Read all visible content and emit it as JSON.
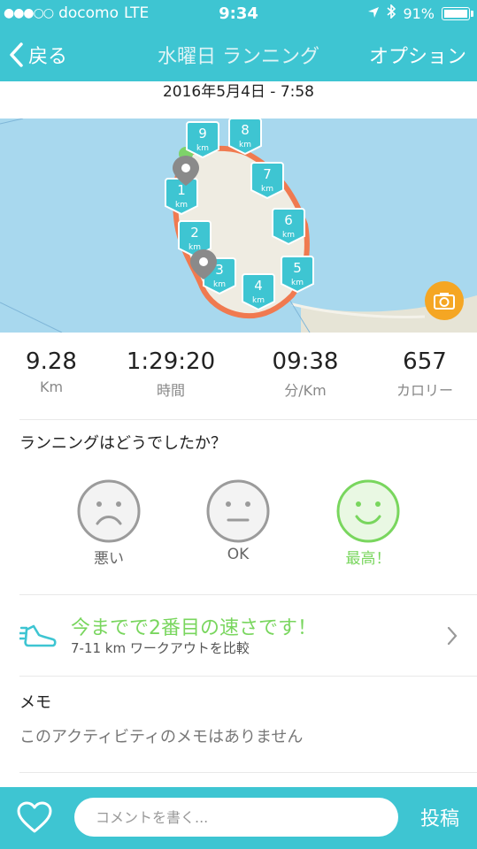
{
  "statusbar": {
    "carrier": "docomo",
    "network": "LTE",
    "time": "9:34",
    "battery": "91%",
    "battery_level": 0.91
  },
  "nav": {
    "back": "戻る",
    "title": "水曜日 ランニング",
    "options": "オプション"
  },
  "date": "2016年5月4日 - 7:58",
  "map": {
    "markers": [
      "1",
      "2",
      "3",
      "4",
      "5",
      "6",
      "7",
      "8",
      "9"
    ],
    "unit": "km"
  },
  "stats": [
    {
      "value": "9.28",
      "label": "Km"
    },
    {
      "value": "1:29:20",
      "label": "時間"
    },
    {
      "value": "09:38",
      "label": "分/Km"
    },
    {
      "value": "657",
      "label": "カロリー"
    }
  ],
  "question": "ランニングはどうでしたか？",
  "moods": [
    {
      "label": "悪い",
      "color": "#999999"
    },
    {
      "label": "OK",
      "color": "#999999"
    },
    {
      "label": "最高！",
      "color": "#79d65e"
    }
  ],
  "compare": {
    "title": "今までで2番目の速さです！",
    "subtitle": "7-11 km ワークアウトを比較"
  },
  "memo": {
    "heading": "メモ",
    "text": "このアクティビティのメモはありません"
  },
  "bottom": {
    "placeholder": "コメントを書く...",
    "post": "投稿"
  },
  "colors": {
    "accent": "#3ec5d2",
    "route": "#f07a50",
    "success": "#79d65e",
    "camera": "#f5a623"
  }
}
